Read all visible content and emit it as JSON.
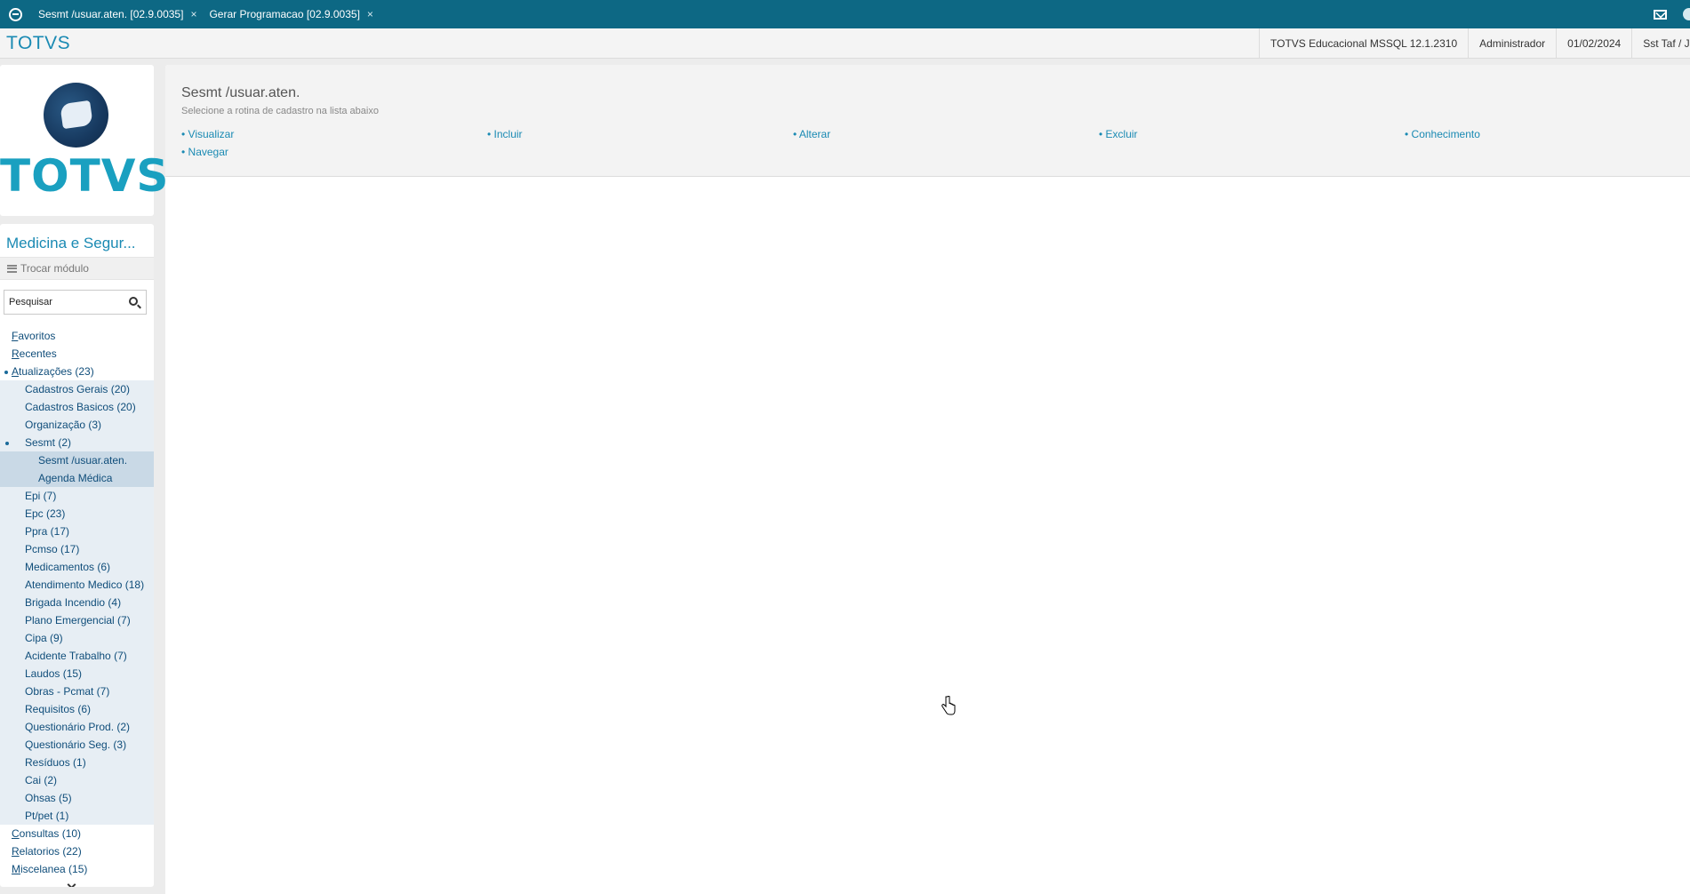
{
  "tabs": [
    {
      "label": "Sesmt /usuar.aten. [02.9.0035]",
      "close": "×"
    },
    {
      "label": "Gerar Programacao [02.9.0035]",
      "close": "×"
    }
  ],
  "header": {
    "brand": "TOTVS",
    "environment": "TOTVS Educacional MSSQL 12.1.2310",
    "user": "Administrador",
    "date": "01/02/2024",
    "branch": "Sst Taf / Julia Sst Ra"
  },
  "sidebar": {
    "logo_text": "TOTVS",
    "module_title": "Medicina e Segur...",
    "switch_module": "Trocar módulo",
    "search_placeholder": "Pesquisar",
    "tree": [
      {
        "first": "F",
        "rest": "avoritos"
      },
      {
        "first": "R",
        "rest": "ecentes"
      },
      {
        "first": "A",
        "rest": "tualizações (23)"
      },
      {
        "label": "Cadastros Gerais (20)"
      },
      {
        "label": "Cadastros Basicos (20)"
      },
      {
        "label": "Organização (3)"
      },
      {
        "label": "Sesmt (2)"
      },
      {
        "label": "Sesmt /usuar.aten."
      },
      {
        "label": "Agenda Médica"
      },
      {
        "label": "Epi (7)"
      },
      {
        "label": "Epc (23)"
      },
      {
        "label": "Ppra (17)"
      },
      {
        "label": "Pcmso (17)"
      },
      {
        "label": "Medicamentos (6)"
      },
      {
        "label": "Atendimento Medico (18)"
      },
      {
        "label": "Brigada Incendio (4)"
      },
      {
        "label": "Plano Emergencial (7)"
      },
      {
        "label": "Cipa (9)"
      },
      {
        "label": "Acidente Trabalho (7)"
      },
      {
        "label": "Laudos (15)"
      },
      {
        "label": "Obras - Pcmat (7)"
      },
      {
        "label": "Requisitos (6)"
      },
      {
        "label": "Questionário Prod. (2)"
      },
      {
        "label": "Questionário Seg. (3)"
      },
      {
        "label": "Resíduos (1)"
      },
      {
        "label": "Cai (2)"
      },
      {
        "label": "Ohsas (5)"
      },
      {
        "label": "Pt/pet (1)"
      },
      {
        "first": "C",
        "rest": "onsultas (10)"
      },
      {
        "first": "R",
        "rest": "elatorios (22)"
      },
      {
        "first": "M",
        "rest": "iscelanea (15)"
      }
    ]
  },
  "main": {
    "title": "Sesmt /usuar.aten.",
    "subtitle": "Selecione a rotina de cadastro na lista abaixo",
    "actions": [
      "• Visualizar",
      "• Incluir",
      "• Alterar",
      "• Excluir",
      "• Conhecimento",
      "• Navegar"
    ]
  },
  "colors": {
    "tabbar": "#0d6884",
    "accent": "#1a8ab3",
    "link": "#0f4d7a"
  }
}
